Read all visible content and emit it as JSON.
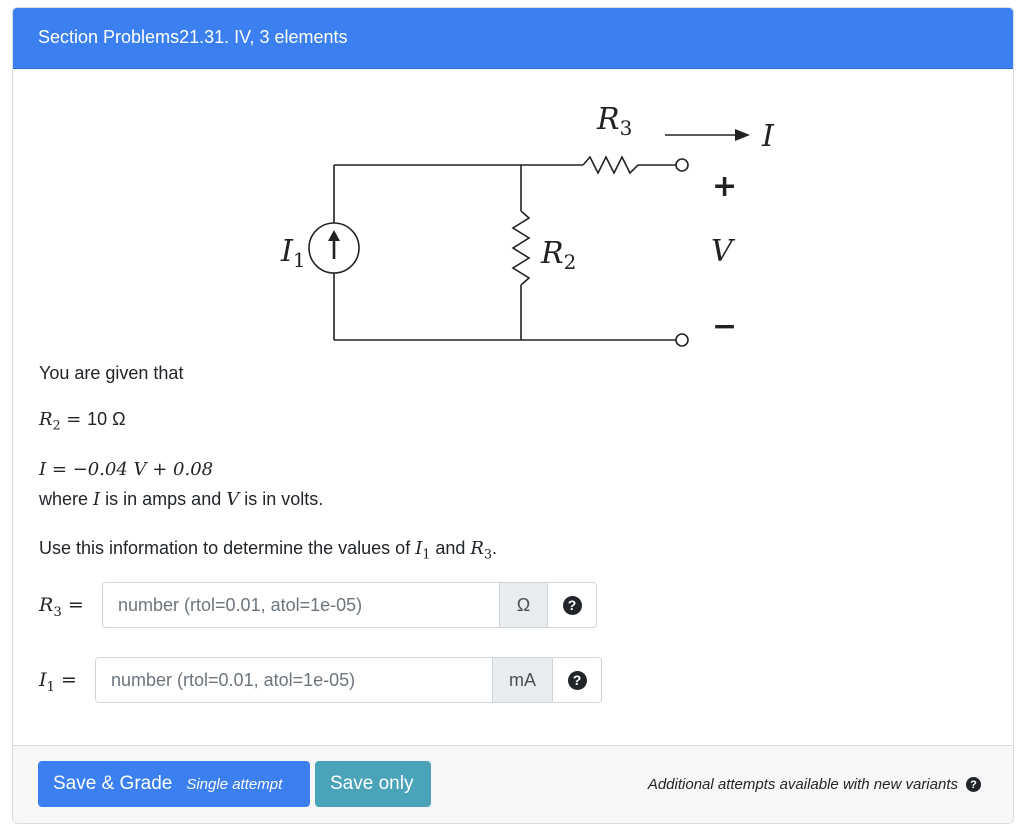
{
  "header": {
    "title": "Section Problems21.31. IV, 3 elements"
  },
  "circuit": {
    "labels": {
      "r3": "R",
      "r3_sub": "3",
      "current": "I",
      "i1": "I",
      "i1_sub": "1",
      "r2": "R",
      "r2_sub": "2",
      "voltage": "V",
      "plus": "+",
      "minus": "−"
    }
  },
  "problem": {
    "intro": "You are given that",
    "r2_lhs": "R",
    "r2_sub": "2",
    "r2_eq": " = ",
    "r2_value": "10 Ω",
    "equation": "I = −0.04 V + 0.08",
    "where_1": "where ",
    "where_I": "I",
    "where_2": " is in amps and ",
    "where_V": "V",
    "where_3": " is in volts.",
    "task_1": "Use this information to determine the values of ",
    "task_I": "I",
    "task_I_sub": "1",
    "task_and": " and ",
    "task_R": "R",
    "task_R_sub": "3",
    "task_end": "."
  },
  "answers": [
    {
      "label_var": "R",
      "label_sub": "3",
      "label_eq": " =",
      "placeholder": "number (rtol=0.01, atol=1e-05)",
      "value": "",
      "unit": "Ω",
      "help": "?"
    },
    {
      "label_var": "I",
      "label_sub": "1",
      "label_eq": " =",
      "placeholder": "number (rtol=0.01, atol=1e-05)",
      "value": "",
      "unit": "mA",
      "help": "?"
    }
  ],
  "footer": {
    "save_grade_label": "Save & Grade",
    "save_grade_sub": "Single attempt",
    "save_only_label": "Save only",
    "note": "Additional attempts available with new variants",
    "note_help": "?"
  },
  "colors": {
    "header_bg": "#3b7ff0",
    "primary": "#3b7ff0",
    "info": "#4aa3b8"
  }
}
